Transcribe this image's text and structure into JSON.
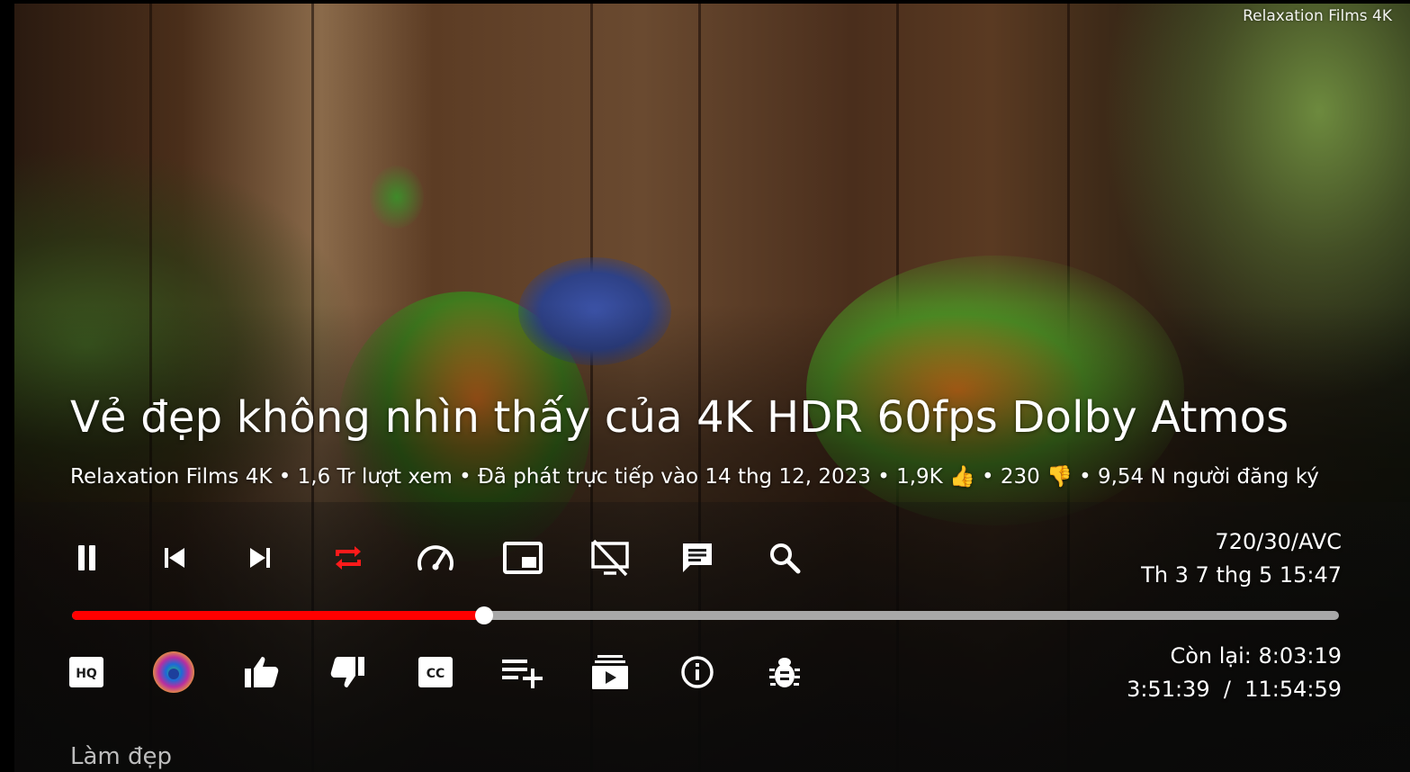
{
  "watermark": "Relaxation Films 4K",
  "video": {
    "title": "Vẻ đẹp không nhìn thấy của 4K HDR 60fps Dolby Atmos",
    "meta": {
      "channel": "Relaxation Films 4K",
      "views": "1,6 Tr lượt xem",
      "streamed": "Đã phát trực tiếp vào 14 thg 12, 2023",
      "likes": "1,9K 👍",
      "dislikes": "230 👎",
      "subscribers": "9,54 N người đăng ký",
      "separator": " • "
    }
  },
  "top_controls": [
    {
      "name": "pause-button",
      "icon": "pause-icon"
    },
    {
      "name": "previous-button",
      "icon": "skip-previous-icon"
    },
    {
      "name": "next-button",
      "icon": "skip-next-icon"
    },
    {
      "name": "repeat-button",
      "icon": "repeat-icon",
      "active": true
    },
    {
      "name": "playback-speed-button",
      "icon": "speedometer-icon"
    },
    {
      "name": "picture-in-picture-button",
      "icon": "pip-icon"
    },
    {
      "name": "screen-off-button",
      "icon": "screen-off-icon"
    },
    {
      "name": "chat-button",
      "icon": "chat-icon"
    },
    {
      "name": "search-button",
      "icon": "search-icon"
    }
  ],
  "bottom_controls": [
    {
      "name": "quality-button",
      "icon": "hq-icon"
    },
    {
      "name": "channel-avatar-button",
      "icon": "channel-avatar"
    },
    {
      "name": "like-button",
      "icon": "thumb-up-icon"
    },
    {
      "name": "dislike-button",
      "icon": "thumb-down-icon"
    },
    {
      "name": "subtitles-button",
      "icon": "cc-icon"
    },
    {
      "name": "add-to-playlist-button",
      "icon": "playlist-add-icon"
    },
    {
      "name": "video-list-button",
      "icon": "subscriptions-icon"
    },
    {
      "name": "video-info-button",
      "icon": "info-icon"
    },
    {
      "name": "debug-button",
      "icon": "bug-icon"
    }
  ],
  "status": {
    "format": "720/30/AVC",
    "clock": "Th 3 7 thg 5 15:47",
    "remaining": "Còn lại: 8:03:19",
    "position": "3:51:39  /  11:54:59"
  },
  "progress": {
    "fraction": 0.325
  },
  "colors": {
    "accent": "#ff0000",
    "track": "#a8a8a8",
    "text": "#ffffff"
  },
  "section": {
    "label": "Làm đẹp"
  }
}
